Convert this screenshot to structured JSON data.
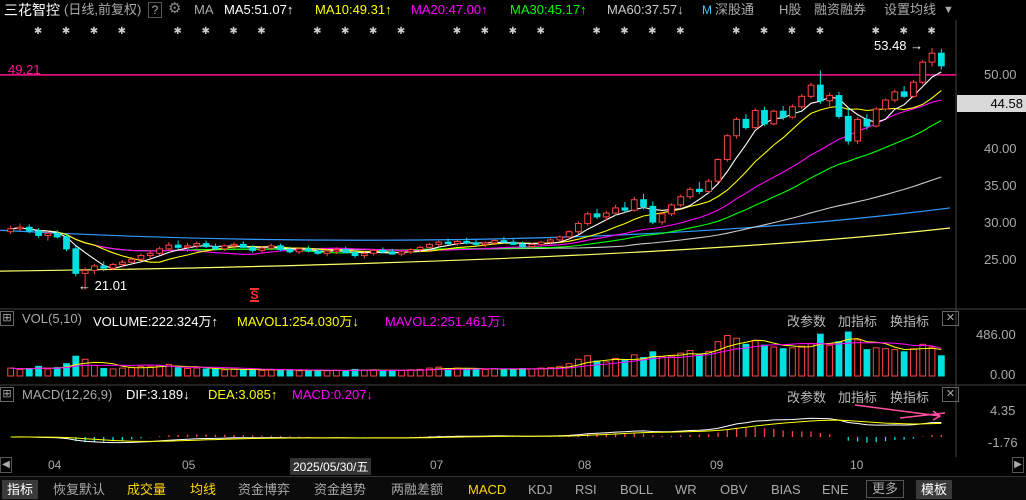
{
  "header": {
    "stock_name": "三花智控",
    "period": "(日线,前复权)",
    "help": "?",
    "ma_label": "MA",
    "ma5": "MA5:51.07↑",
    "ma10": "MA10:49.31↑",
    "ma20": "MA20:47.00↑",
    "ma30": "MA30:45.17↑",
    "ma60": "MA60:37.57↓",
    "shenzhen_connect": "深股通",
    "h_share": "H股",
    "margin": "融资融券",
    "ma_setting": "设置均线"
  },
  "price_panel": {
    "ref_line_value": "49.21",
    "high_label": "53.48",
    "low_label": "21.01",
    "current_price": "44.58",
    "y_ticks": [
      "50.00",
      "45.00",
      "40.00",
      "35.00",
      "30.00",
      "25.00"
    ],
    "event_marker": "S"
  },
  "volume_panel": {
    "title": "VOL(5,10)",
    "volume": "VOLUME:222.324万↑",
    "mavol1": "MAVOL1:254.030万↓",
    "mavol2": "MAVOL2:251.461万↓",
    "y_top": "486.00",
    "y_bottom": "0.00",
    "btn_params": "改参数",
    "btn_add": "加指标",
    "btn_switch": "换指标",
    "close": "✕"
  },
  "macd_panel": {
    "title": "MACD(12,26,9)",
    "dif": "DIF:3.189↓",
    "dea": "DEA:3.085↑",
    "macd": "MACD:0.207↓",
    "y_top": "4.35",
    "y_bottom": "-1.76",
    "btn_params": "改参数",
    "btn_add": "加指标",
    "btn_switch": "换指标",
    "close": "✕"
  },
  "date_axis": {
    "labels": [
      "04",
      "05",
      "2025/05/30/五",
      "07",
      "08",
      "09",
      "10"
    ]
  },
  "tabs": [
    {
      "label": "指标"
    },
    {
      "label": "恢复默认"
    },
    {
      "label": "成交量"
    },
    {
      "label": "均线"
    },
    {
      "label": "资金博弈"
    },
    {
      "label": "资金趋势"
    },
    {
      "label": "两融差额"
    },
    {
      "label": "MACD"
    },
    {
      "label": "KDJ"
    },
    {
      "label": "RSI"
    },
    {
      "label": "BOLL"
    },
    {
      "label": "WR"
    },
    {
      "label": "OBV"
    },
    {
      "label": "BIAS"
    },
    {
      "label": "ENE"
    },
    {
      "label": "更多"
    },
    {
      "label": "模板"
    }
  ],
  "colors": {
    "up": "#ff4444",
    "down": "#00e0e0",
    "ma5": "#ffffff",
    "ma10": "#ffff00",
    "ma20": "#ff00ff",
    "ma30": "#00ff00",
    "ma60": "#cccccc",
    "ref_line": "#ff1493"
  },
  "candles": [
    [
      28.8,
      29.6,
      28.5,
      29.2
    ],
    [
      29.2,
      29.9,
      28.9,
      29.4
    ],
    [
      29.4,
      29.8,
      28.6,
      28.9
    ],
    [
      28.9,
      29.3,
      28.0,
      28.3
    ],
    [
      28.3,
      28.9,
      27.6,
      28.6
    ],
    [
      28.6,
      29.0,
      27.9,
      28.1
    ],
    [
      28.1,
      28.4,
      26.2,
      26.5
    ],
    [
      26.5,
      26.9,
      22.8,
      23.2
    ],
    [
      23.2,
      24.0,
      21.0,
      23.6
    ],
    [
      23.6,
      24.5,
      23.1,
      24.2
    ],
    [
      24.2,
      24.8,
      23.5,
      23.9
    ],
    [
      23.9,
      24.6,
      23.6,
      24.4
    ],
    [
      24.4,
      25.0,
      24.0,
      24.7
    ],
    [
      24.7,
      25.4,
      24.3,
      25.1
    ],
    [
      25.1,
      25.9,
      24.8,
      25.6
    ],
    [
      25.6,
      26.3,
      25.2,
      25.9
    ],
    [
      25.9,
      26.8,
      25.6,
      26.5
    ],
    [
      26.5,
      27.4,
      26.2,
      27.0
    ],
    [
      27.0,
      27.6,
      26.4,
      26.7
    ],
    [
      26.7,
      27.3,
      26.1,
      26.9
    ],
    [
      26.9,
      27.5,
      26.5,
      27.2
    ],
    [
      27.2,
      27.6,
      26.6,
      26.8
    ],
    [
      26.8,
      27.2,
      26.3,
      26.5
    ],
    [
      26.5,
      27.1,
      26.2,
      26.9
    ],
    [
      26.9,
      27.4,
      26.5,
      27.1
    ],
    [
      27.1,
      27.5,
      26.6,
      26.7
    ],
    [
      26.7,
      27.0,
      26.0,
      26.3
    ],
    [
      26.3,
      26.9,
      26.0,
      26.6
    ],
    [
      26.6,
      27.2,
      26.3,
      26.9
    ],
    [
      26.9,
      27.2,
      26.2,
      26.4
    ],
    [
      26.4,
      26.8,
      25.9,
      26.1
    ],
    [
      26.1,
      26.7,
      25.8,
      26.5
    ],
    [
      26.5,
      26.9,
      26.0,
      26.2
    ],
    [
      26.2,
      26.6,
      25.7,
      25.9
    ],
    [
      25.9,
      26.4,
      25.5,
      26.2
    ],
    [
      26.2,
      26.7,
      25.8,
      26.4
    ],
    [
      26.4,
      26.8,
      25.9,
      26.0
    ],
    [
      26.0,
      26.4,
      25.3,
      25.6
    ],
    [
      25.6,
      26.1,
      25.2,
      25.9
    ],
    [
      25.9,
      26.5,
      25.6,
      26.3
    ],
    [
      26.3,
      26.7,
      25.9,
      26.1
    ],
    [
      26.1,
      26.5,
      25.7,
      25.8
    ],
    [
      25.8,
      26.3,
      25.5,
      26.1
    ],
    [
      26.1,
      26.6,
      25.8,
      26.4
    ],
    [
      26.4,
      26.9,
      26.1,
      26.7
    ],
    [
      26.7,
      27.3,
      26.4,
      27.1
    ],
    [
      27.1,
      27.6,
      26.8,
      27.4
    ],
    [
      27.4,
      27.9,
      27.0,
      27.2
    ],
    [
      27.2,
      27.7,
      26.9,
      27.5
    ],
    [
      27.5,
      28.0,
      27.1,
      27.3
    ],
    [
      27.3,
      27.7,
      26.9,
      27.1
    ],
    [
      27.1,
      27.5,
      26.7,
      27.3
    ],
    [
      27.3,
      27.8,
      27.0,
      27.6
    ],
    [
      27.6,
      28.1,
      27.2,
      27.4
    ],
    [
      27.4,
      27.8,
      27.0,
      27.1
    ],
    [
      27.1,
      27.5,
      26.6,
      26.8
    ],
    [
      26.8,
      27.3,
      26.5,
      27.1
    ],
    [
      27.1,
      27.6,
      26.8,
      27.4
    ],
    [
      27.4,
      27.9,
      27.1,
      27.7
    ],
    [
      27.7,
      28.3,
      27.4,
      28.1
    ],
    [
      28.1,
      29.0,
      27.8,
      28.8
    ],
    [
      28.8,
      30.2,
      28.5,
      29.9
    ],
    [
      29.9,
      31.5,
      29.6,
      31.2
    ],
    [
      31.2,
      31.9,
      30.5,
      30.8
    ],
    [
      30.8,
      31.6,
      30.3,
      31.3
    ],
    [
      31.3,
      32.4,
      31.0,
      32.0
    ],
    [
      32.0,
      32.8,
      31.4,
      31.7
    ],
    [
      31.7,
      33.5,
      31.5,
      33.1
    ],
    [
      33.1,
      33.9,
      31.8,
      32.2
    ],
    [
      32.2,
      32.9,
      29.8,
      30.1
    ],
    [
      30.1,
      31.5,
      29.7,
      31.2
    ],
    [
      31.2,
      32.6,
      30.9,
      32.4
    ],
    [
      32.4,
      33.8,
      32.1,
      33.5
    ],
    [
      33.5,
      34.8,
      33.2,
      34.5
    ],
    [
      34.5,
      35.5,
      33.9,
      34.2
    ],
    [
      34.2,
      35.9,
      34.0,
      35.6
    ],
    [
      35.6,
      38.7,
      35.4,
      38.5
    ],
    [
      38.5,
      41.9,
      38.2,
      41.7
    ],
    [
      41.7,
      44.2,
      41.3,
      43.9
    ],
    [
      43.9,
      44.6,
      42.5,
      42.8
    ],
    [
      42.8,
      45.4,
      42.6,
      45.1
    ],
    [
      45.1,
      45.6,
      43.0,
      43.3
    ],
    [
      43.3,
      45.2,
      43.1,
      45.0
    ],
    [
      45.0,
      45.7,
      43.8,
      44.2
    ],
    [
      44.2,
      45.9,
      44.0,
      45.6
    ],
    [
      45.6,
      47.3,
      45.3,
      47.0
    ],
    [
      47.0,
      48.8,
      46.7,
      48.5
    ],
    [
      48.5,
      50.5,
      46.0,
      46.4
    ],
    [
      46.4,
      47.5,
      45.5,
      47.1
    ],
    [
      47.1,
      47.6,
      44.0,
      44.3
    ],
    [
      44.3,
      45.4,
      40.5,
      41.0
    ],
    [
      41.0,
      44.2,
      40.6,
      43.9
    ],
    [
      43.9,
      44.6,
      42.5,
      43.0
    ],
    [
      43.0,
      45.6,
      42.8,
      45.3
    ],
    [
      45.3,
      46.7,
      45.0,
      46.5
    ],
    [
      46.5,
      47.9,
      46.2,
      47.6
    ],
    [
      47.6,
      48.4,
      46.8,
      47.0
    ],
    [
      47.0,
      49.2,
      46.8,
      48.9
    ],
    [
      48.9,
      51.9,
      48.6,
      51.6
    ],
    [
      51.6,
      53.5,
      51.0,
      52.8
    ],
    [
      52.8,
      53.4,
      50.6,
      51.1
    ]
  ],
  "volumes": [
    [
      0.18,
      1
    ],
    [
      0.15,
      1
    ],
    [
      0.17,
      0
    ],
    [
      0.22,
      0
    ],
    [
      0.16,
      1
    ],
    [
      0.19,
      0
    ],
    [
      0.28,
      0
    ],
    [
      0.45,
      0
    ],
    [
      0.38,
      1
    ],
    [
      0.24,
      1
    ],
    [
      0.17,
      0
    ],
    [
      0.16,
      1
    ],
    [
      0.18,
      1
    ],
    [
      0.2,
      1
    ],
    [
      0.22,
      1
    ],
    [
      0.21,
      1
    ],
    [
      0.24,
      1
    ],
    [
      0.26,
      1
    ],
    [
      0.19,
      0
    ],
    [
      0.17,
      1
    ],
    [
      0.18,
      1
    ],
    [
      0.16,
      0
    ],
    [
      0.15,
      0
    ],
    [
      0.14,
      1
    ],
    [
      0.15,
      1
    ],
    [
      0.14,
      0
    ],
    [
      0.16,
      0
    ],
    [
      0.13,
      1
    ],
    [
      0.14,
      1
    ],
    [
      0.13,
      0
    ],
    [
      0.14,
      0
    ],
    [
      0.12,
      1
    ],
    [
      0.12,
      0
    ],
    [
      0.13,
      0
    ],
    [
      0.12,
      1
    ],
    [
      0.13,
      1
    ],
    [
      0.12,
      0
    ],
    [
      0.15,
      0
    ],
    [
      0.13,
      1
    ],
    [
      0.14,
      1
    ],
    [
      0.12,
      0
    ],
    [
      0.12,
      0
    ],
    [
      0.13,
      1
    ],
    [
      0.14,
      1
    ],
    [
      0.15,
      1
    ],
    [
      0.18,
      1
    ],
    [
      0.2,
      1
    ],
    [
      0.17,
      0
    ],
    [
      0.18,
      1
    ],
    [
      0.16,
      0
    ],
    [
      0.15,
      0
    ],
    [
      0.15,
      1
    ],
    [
      0.17,
      1
    ],
    [
      0.16,
      0
    ],
    [
      0.15,
      0
    ],
    [
      0.17,
      0
    ],
    [
      0.16,
      1
    ],
    [
      0.18,
      1
    ],
    [
      0.19,
      1
    ],
    [
      0.22,
      1
    ],
    [
      0.28,
      1
    ],
    [
      0.38,
      1
    ],
    [
      0.46,
      1
    ],
    [
      0.34,
      0
    ],
    [
      0.32,
      1
    ],
    [
      0.4,
      1
    ],
    [
      0.35,
      0
    ],
    [
      0.48,
      1
    ],
    [
      0.42,
      0
    ],
    [
      0.55,
      0
    ],
    [
      0.44,
      1
    ],
    [
      0.45,
      1
    ],
    [
      0.52,
      1
    ],
    [
      0.58,
      1
    ],
    [
      0.5,
      0
    ],
    [
      0.56,
      1
    ],
    [
      0.78,
      1
    ],
    [
      0.92,
      1
    ],
    [
      0.86,
      1
    ],
    [
      0.72,
      0
    ],
    [
      0.8,
      1
    ],
    [
      0.7,
      0
    ],
    [
      0.66,
      1
    ],
    [
      0.62,
      0
    ],
    [
      0.64,
      1
    ],
    [
      0.68,
      1
    ],
    [
      0.74,
      1
    ],
    [
      0.95,
      0
    ],
    [
      0.7,
      1
    ],
    [
      0.78,
      0
    ],
    [
      1.0,
      0
    ],
    [
      0.82,
      1
    ],
    [
      0.6,
      0
    ],
    [
      0.64,
      1
    ],
    [
      0.62,
      1
    ],
    [
      0.6,
      1
    ],
    [
      0.55,
      0
    ],
    [
      0.62,
      1
    ],
    [
      0.72,
      1
    ],
    [
      0.66,
      1
    ],
    [
      0.46,
      0
    ]
  ]
}
